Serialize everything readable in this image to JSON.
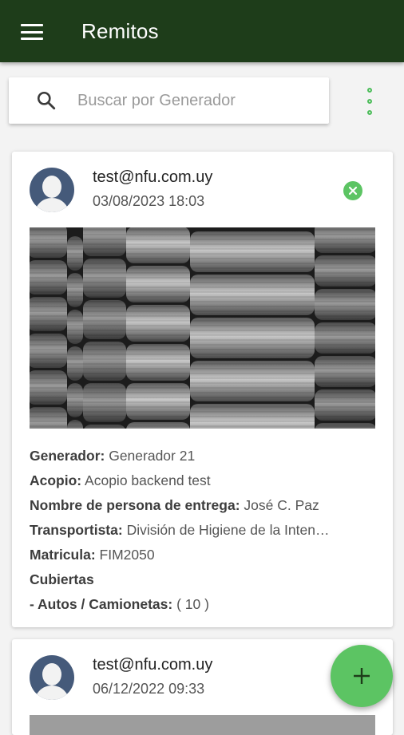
{
  "app_bar": {
    "title": "Remitos",
    "menu_icon": "hamburger-menu-icon"
  },
  "search": {
    "placeholder": "Buscar por Generador",
    "value": "",
    "icon": "search-icon"
  },
  "overflow_menu_icon": "more-vert-icon",
  "remitos": [
    {
      "email": "test@nfu.com.uy",
      "date": "03/08/2023 18:03",
      "status_icon": "close-circle-icon",
      "image": "tire-stacks-photo",
      "details": {
        "generador_label": "Generador:",
        "generador_value": "Generador 21",
        "acopio_label": "Acopio:",
        "acopio_value": "Acopio backend test",
        "entrega_label": "Nombre de persona de entrega:",
        "entrega_value": "José C. Paz",
        "transportista_label": "Transportista:",
        "transportista_value": "División de Higiene de la Inten…",
        "matricula_label": "Matricula:",
        "matricula_value": "FIM2050",
        "cubiertas_label": "Cubiertas",
        "autos_label": "- Autos / Camionetas:",
        "autos_value": "( 10 )"
      }
    },
    {
      "email": "test@nfu.com.uy",
      "date": "06/12/2022 09:33"
    }
  ],
  "fab": {
    "icon": "plus-icon"
  },
  "colors": {
    "app_bar": "#1e3d1a",
    "accent": "#5cc463",
    "background": "#f3f3f3"
  }
}
